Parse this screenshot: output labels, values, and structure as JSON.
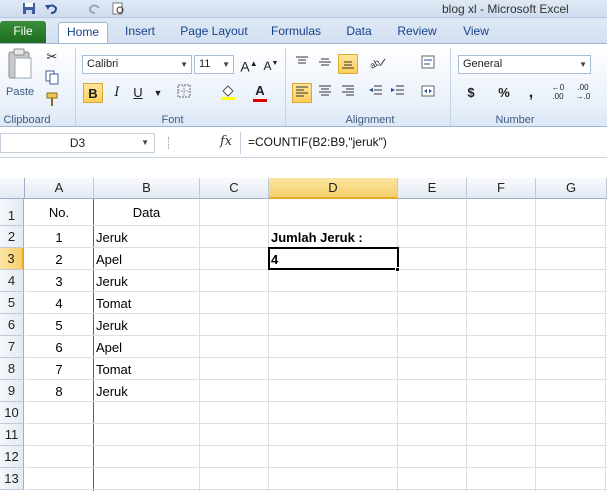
{
  "window": {
    "title": "blog xl  -  Microsoft Excel"
  },
  "tabs": [
    "File",
    "Home",
    "Insert",
    "Page Layout",
    "Formulas",
    "Data",
    "Review",
    "View"
  ],
  "ribbon": {
    "clipboard": {
      "label": "Clipboard",
      "paste": "Paste"
    },
    "font": {
      "label": "Font",
      "name": "Calibri",
      "size": "11"
    },
    "alignment": {
      "label": "Alignment"
    },
    "number": {
      "label": "Number",
      "format": "General"
    }
  },
  "formula_bar": {
    "name_box": "D3",
    "fx": "fx",
    "formula": "=COUNTIF(B2:B9,\"jeruk\")"
  },
  "columns": [
    "A",
    "B",
    "C",
    "D",
    "E",
    "F",
    "G"
  ],
  "rows": [
    "1",
    "2",
    "3",
    "4",
    "5",
    "6",
    "7",
    "8",
    "9",
    "10",
    "11",
    "12",
    "13"
  ],
  "cells": {
    "A1": "No.",
    "B1": "Data",
    "A2": "1",
    "B2": "Jeruk",
    "A3": "2",
    "B3": "Apel",
    "A4": "3",
    "B4": "Jeruk",
    "A5": "4",
    "B5": "Tomat",
    "A6": "5",
    "B6": "Jeruk",
    "A7": "6",
    "B7": "Apel",
    "A8": "7",
    "B8": "Tomat",
    "A9": "8",
    "B9": "Jeruk",
    "D2": "Jumlah Jeruk :",
    "D3": "4"
  },
  "colors": {
    "accent_green": "#1e6d1e",
    "selection": "#000000",
    "header_select": "#f6cf6a"
  }
}
